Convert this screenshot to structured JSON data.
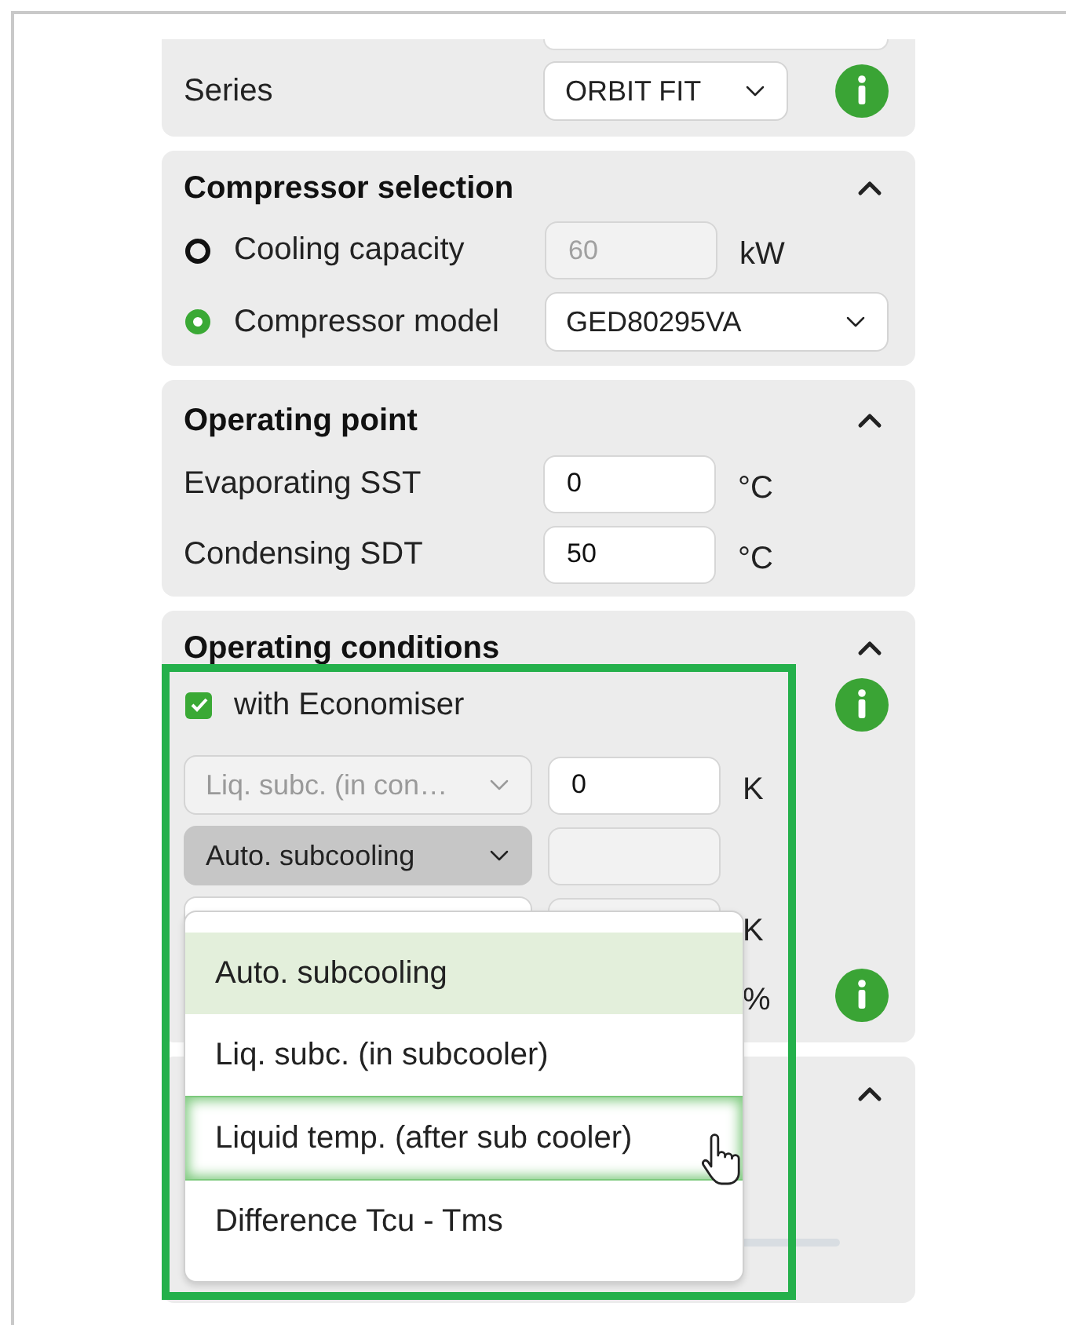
{
  "series_panel": {
    "label": "Series",
    "value": "ORBIT FIT"
  },
  "compressor_selection": {
    "title": "Compressor selection",
    "expanded": true,
    "options": [
      {
        "kind": "input",
        "label": "Cooling capacity",
        "selected": false,
        "value": "60",
        "unit": "kW"
      },
      {
        "kind": "select",
        "label": "Compressor model",
        "selected": true,
        "value": "GED80295VA"
      }
    ]
  },
  "operating_point": {
    "title": "Operating point",
    "expanded": true,
    "fields": [
      {
        "label": "Evaporating SST",
        "value": "0",
        "unit": "°C"
      },
      {
        "label": "Condensing SDT",
        "value": "50",
        "unit": "°C"
      }
    ]
  },
  "operating_conditions": {
    "title": "Operating conditions",
    "expanded": true,
    "economiser": {
      "label": "with Economiser",
      "checked": true
    },
    "rows": [
      {
        "kind": "select_field",
        "select": "Liq. subc. (in con…",
        "disabled": true,
        "open": false,
        "value": "0",
        "unit": "K"
      },
      {
        "kind": "select_field",
        "select": "Auto. subcooling",
        "disabled": false,
        "open": true
      },
      {
        "kind": "select_field",
        "disabled": false,
        "open": false,
        "unit": "K"
      },
      {
        "kind": "unit_only",
        "unit": "%"
      }
    ]
  },
  "next_panel": {
    "expanded": true
  },
  "dropdown": {
    "options": [
      {
        "label": "Auto. subcooling",
        "selected": true,
        "hovered": false
      },
      {
        "label": "Liq. subc. (in subcooler)",
        "selected": false,
        "hovered": false
      },
      {
        "label": "Liquid temp. (after sub cooler)",
        "selected": false,
        "hovered": true
      },
      {
        "label": "Difference Tcu - Tms",
        "selected": false,
        "hovered": false
      }
    ]
  }
}
